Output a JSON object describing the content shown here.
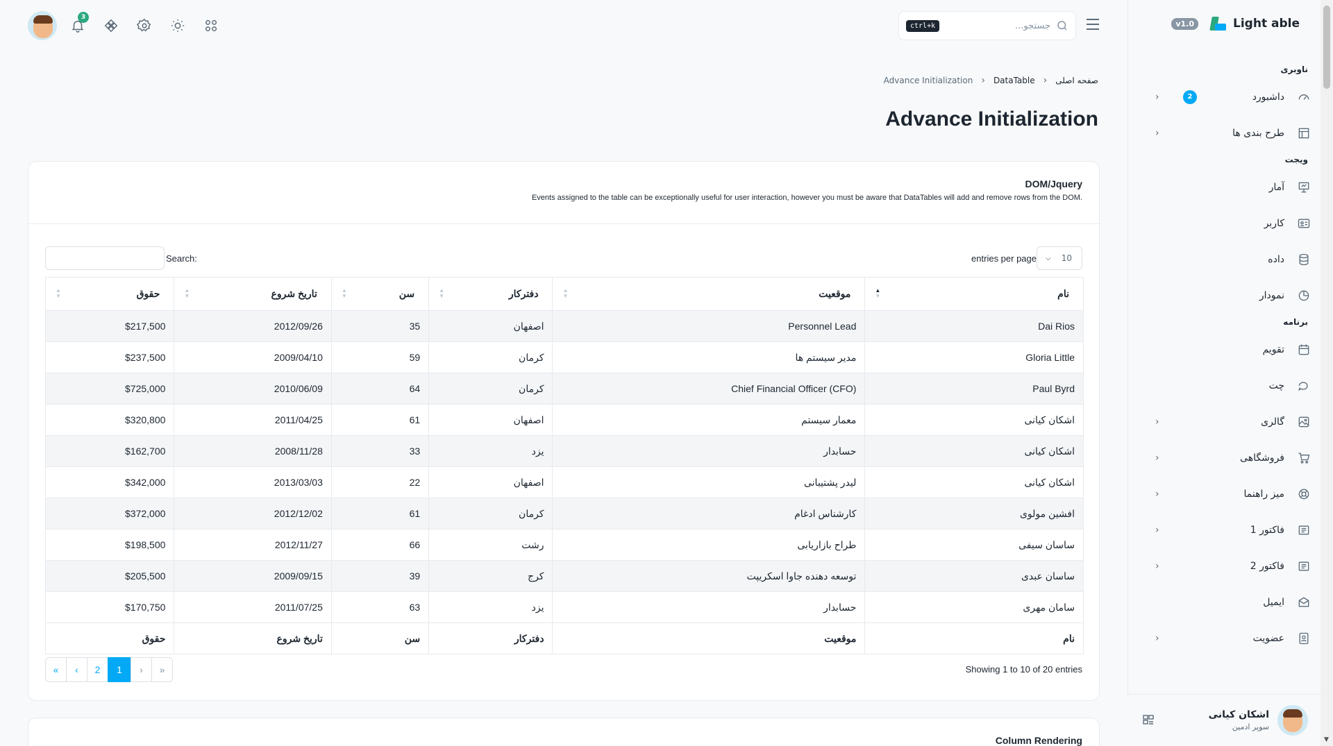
{
  "brand": {
    "name": "Light able",
    "version": "v1.0"
  },
  "header": {
    "search_placeholder": "جستجو...",
    "search_shortcut": "ctrl+k",
    "notification_count": "3"
  },
  "sidebar": {
    "sections": [
      {
        "caption": "ناوبری",
        "items": [
          {
            "label": "داشبورد",
            "icon": "dashboard-icon",
            "badge": "2",
            "chevron": true
          },
          {
            "label": "طرح بندی ها",
            "icon": "layout-icon",
            "chevron": true
          }
        ]
      },
      {
        "caption": "ویجت",
        "items": [
          {
            "label": "آمار",
            "icon": "presentation-icon"
          },
          {
            "label": "کاربر",
            "icon": "id-card-icon"
          },
          {
            "label": "داده",
            "icon": "database-icon"
          },
          {
            "label": "نمودار",
            "icon": "pie-chart-icon"
          }
        ]
      },
      {
        "caption": "برنامه",
        "items": [
          {
            "label": "تقویم",
            "icon": "calendar-icon"
          },
          {
            "label": "چت",
            "icon": "chat-icon"
          },
          {
            "label": "گالری",
            "icon": "gallery-icon",
            "chevron": true
          },
          {
            "label": "فروشگاهی",
            "icon": "cart-icon",
            "chevron": true
          },
          {
            "label": "میز راهنما",
            "icon": "lifebuoy-icon",
            "chevron": true
          },
          {
            "label": "فاکتور 1",
            "icon": "invoice-icon",
            "chevron": true
          },
          {
            "label": "فاکتور 2",
            "icon": "invoice-icon",
            "chevron": true
          },
          {
            "label": "ایمیل",
            "icon": "mail-icon"
          },
          {
            "label": "عضویت",
            "icon": "membership-icon",
            "chevron": true
          }
        ]
      }
    ],
    "user": {
      "name": "اشکان کیانی",
      "role": "سوپر ادمین"
    }
  },
  "breadcrumb": {
    "home": "صفحه اصلی",
    "section": "DataTable",
    "current": "Advance Initialization"
  },
  "page_title": "Advance Initialization",
  "card": {
    "title": "DOM/Jquery",
    "description": "Events assigned to the table can be exceptionally useful for user interaction, however you must be aware that DataTables will add and remove rows from the DOM.",
    "length_value": "10",
    "length_label": "entries per page",
    "search_label": "Search:",
    "columns": [
      "نام",
      "موقعیت",
      "دفترکار",
      "سن",
      "تاریخ شروع",
      "حقوق"
    ],
    "rows": [
      [
        "Dai Rios",
        "Personnel Lead",
        "اصفهان",
        "35",
        "2012/09/26",
        "$217,500"
      ],
      [
        "Gloria Little",
        "مدیر سیستم ها",
        "کرمان",
        "59",
        "2009/04/10",
        "$237,500"
      ],
      [
        "Paul Byrd",
        "Chief Financial Officer (CFO)",
        "کرمان",
        "64",
        "2010/06/09",
        "$725,000"
      ],
      [
        "اشکان کیانی",
        "معمار سیستم",
        "اصفهان",
        "61",
        "2011/04/25",
        "$320,800"
      ],
      [
        "اشکان کیانی",
        "حسابدار",
        "یزد",
        "33",
        "2008/11/28",
        "$162,700"
      ],
      [
        "اشکان کیانی",
        "لیدر پشتیبانی",
        "اصفهان",
        "22",
        "2013/03/03",
        "$342,000"
      ],
      [
        "افشین مولوی",
        "کارشناس ادغام",
        "کرمان",
        "61",
        "2012/12/02",
        "$372,000"
      ],
      [
        "ساسان سیفی",
        "طراح بازاریابی",
        "رشت",
        "66",
        "2012/11/27",
        "$198,500"
      ],
      [
        "ساسان عبدی",
        "توسعه دهنده جاوا اسکریپت",
        "کرج",
        "39",
        "2009/09/15",
        "$205,500"
      ],
      [
        "سامان مهری",
        "حسابدار",
        "یزد",
        "63",
        "2011/07/25",
        "$170,750"
      ]
    ],
    "info": "Showing 1 to 10 of 20 entries",
    "pager": [
      "«",
      "‹",
      "2",
      "1",
      "›",
      "»"
    ]
  },
  "card2": {
    "title": "Column Rendering"
  }
}
